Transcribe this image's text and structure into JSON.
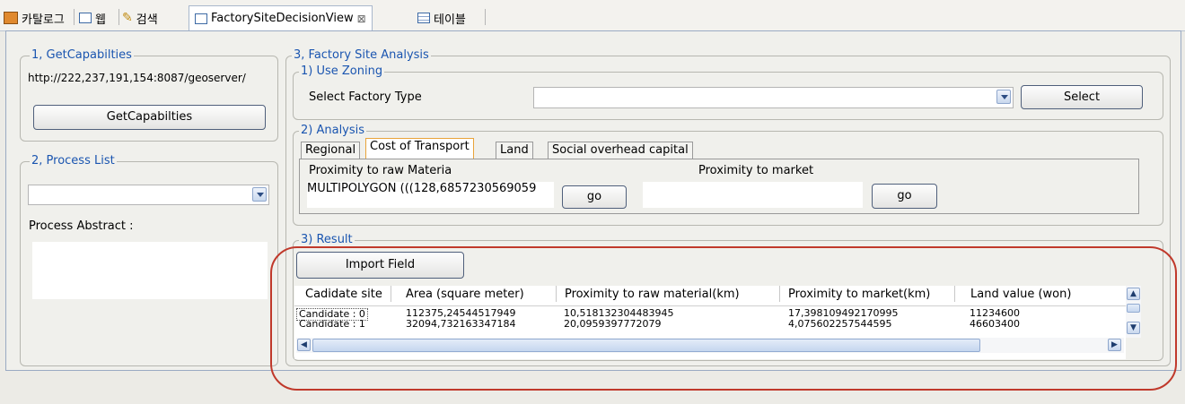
{
  "tabs": [
    {
      "label": "카탈로그"
    },
    {
      "label": "웹"
    },
    {
      "label": "검색"
    },
    {
      "label": "FactorySiteDecisionView"
    },
    {
      "label": "테이블"
    }
  ],
  "close_glyph": "⊠",
  "getcap": {
    "legend": "1, GetCapabilties",
    "url": "http://222,237,191,154:8087/geoserver/",
    "button": "GetCapabilties"
  },
  "process": {
    "legend": "2, Process List",
    "selected": "",
    "abstract_label": "Process Abstract :"
  },
  "analysis_panel": {
    "legend": "3, Factory Site Analysis",
    "zoning": {
      "legend": "1) Use Zoning",
      "label": "Select Factory Type",
      "selected": "",
      "button": "Select"
    },
    "analysis": {
      "legend": "2) Analysis",
      "tabs": [
        "Regional",
        "Cost of Transport",
        "Land",
        "Social overhead capital"
      ],
      "raw_label": "Proximity to raw Materia",
      "raw_value": "MULTIPOLYGON (((128,6857230569059",
      "go1": "go",
      "market_label": "Proximity to market",
      "market_value": "",
      "go2": "go"
    },
    "result": {
      "legend": "3) Result",
      "import_button": "Import Field",
      "columns": [
        "Cadidate site",
        "Area (square meter)",
        "Proximity to raw material(km)",
        "Proximity to market(km)",
        "Land value (won)"
      ],
      "rows": [
        [
          "Candidate : 0",
          "112375,24544517949",
          "10,518132304483945",
          "17,398109492170995",
          "11234600"
        ],
        [
          "Candidate : 1",
          "32094,732163347184",
          "20,0959397772079",
          "4,075602257544595",
          "46603400"
        ]
      ]
    }
  },
  "colors": {
    "accent": "#1a55b0",
    "highlight_ellipse": "#c0392b",
    "selected_tab_border": "#e9a43a"
  }
}
